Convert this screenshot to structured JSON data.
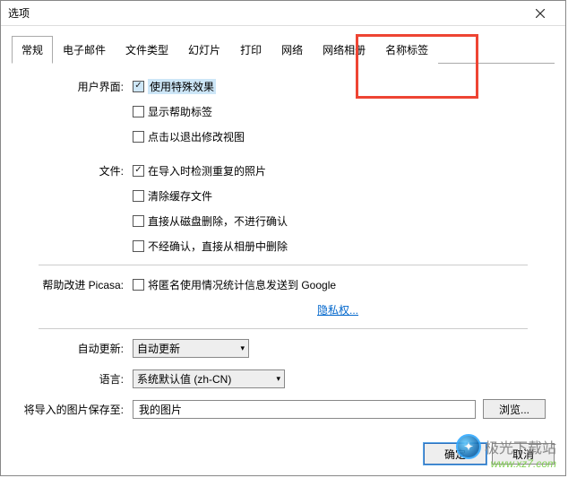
{
  "window": {
    "title": "选项"
  },
  "tabs": {
    "items": [
      {
        "label": "常规"
      },
      {
        "label": "电子邮件"
      },
      {
        "label": "文件类型"
      },
      {
        "label": "幻灯片"
      },
      {
        "label": "打印"
      },
      {
        "label": "网络"
      },
      {
        "label": "网络相册"
      },
      {
        "label": "名称标签"
      }
    ],
    "active_index": 0
  },
  "section_ui": {
    "label": "用户界面:",
    "checks": [
      {
        "label": "使用特殊效果",
        "checked": true
      },
      {
        "label": "显示帮助标签",
        "checked": false
      },
      {
        "label": "点击以退出修改视图",
        "checked": false
      }
    ]
  },
  "section_files": {
    "label": "文件:",
    "checks": [
      {
        "label": "在导入时检测重复的照片",
        "checked": true
      },
      {
        "label": "清除缓存文件",
        "checked": false
      },
      {
        "label": "直接从磁盘删除，不进行确认",
        "checked": false
      },
      {
        "label": "不经确认，直接从相册中删除",
        "checked": false
      }
    ]
  },
  "section_improve": {
    "label": "帮助改进 Picasa:",
    "check_label": "将匿名使用情况统计信息发送到 Google",
    "checked": false,
    "privacy_link": "隐私权..."
  },
  "section_update": {
    "label": "自动更新:",
    "value": "自动更新"
  },
  "section_lang": {
    "label": "语言:",
    "value": "系统默认值 (zh-CN)"
  },
  "section_import": {
    "label": "将导入的图片保存至:",
    "value": "我的图片",
    "browse": "浏览..."
  },
  "footer": {
    "ok": "确定",
    "cancel": "取消"
  },
  "watermark": {
    "text": "极光下载站",
    "url": "www.xz7.com"
  }
}
